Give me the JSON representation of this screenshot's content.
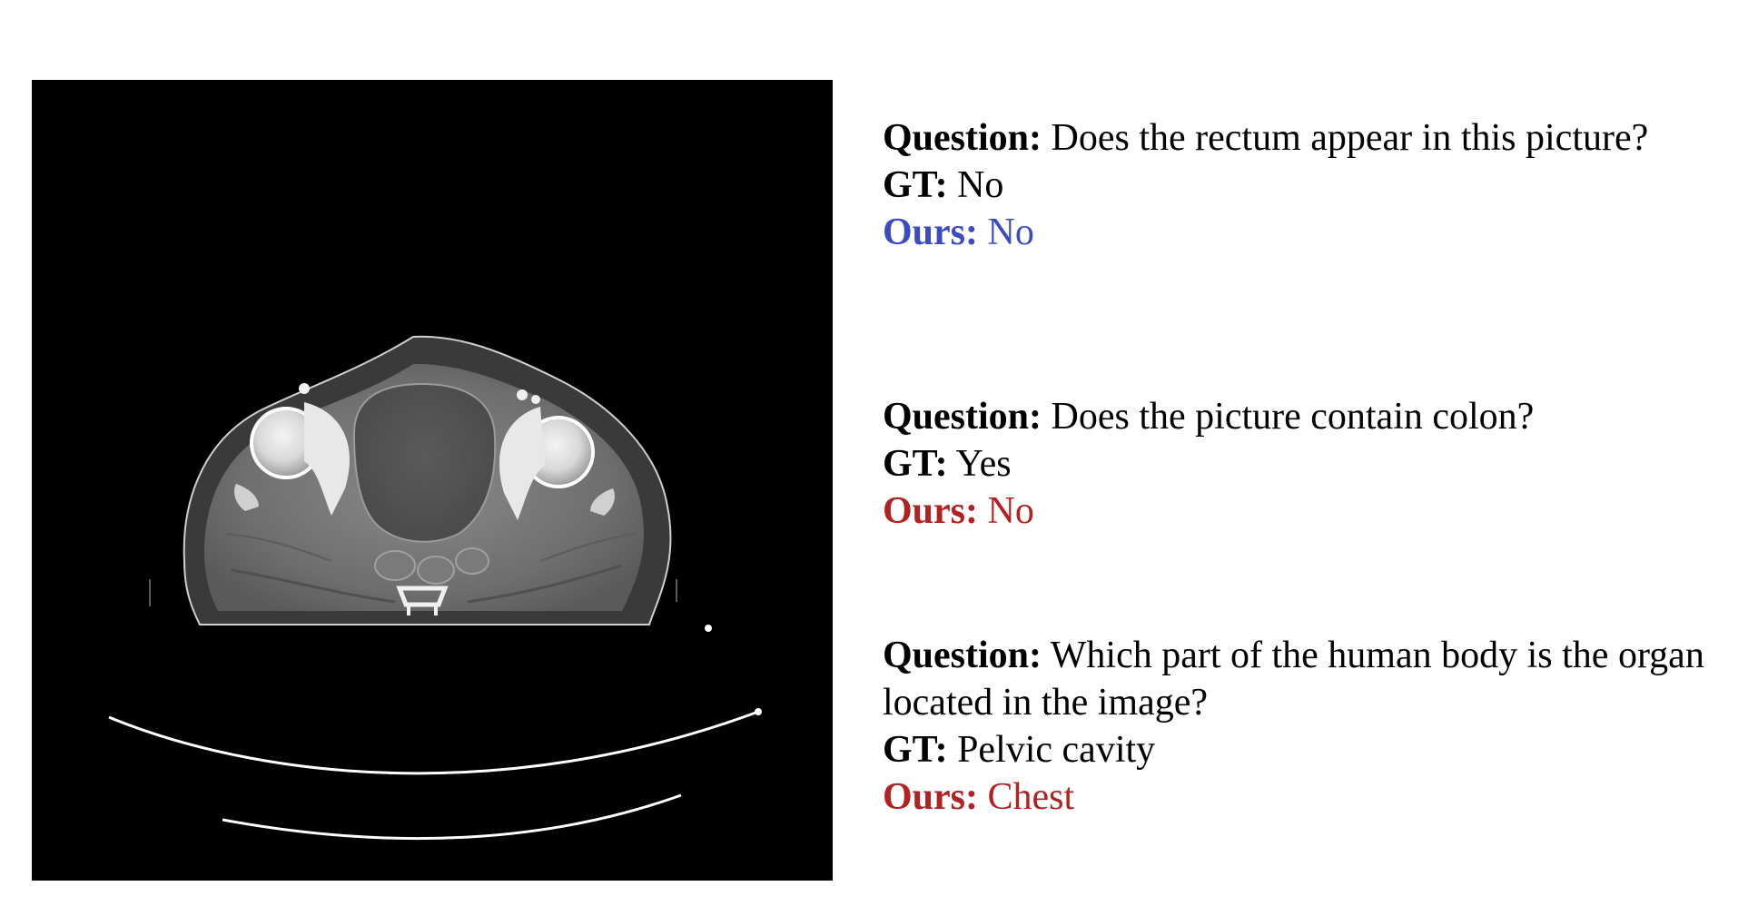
{
  "figure": {
    "image_alt": "Axial CT scan of the pelvis",
    "qa": [
      {
        "question_label": "Question:",
        "question": "Does the rectum appear in this picture?",
        "gt_label": "GT:",
        "gt": "No",
        "ours_label": "Ours:",
        "ours": "No",
        "ours_color": "#3b4cc0",
        "ours_correct": true
      },
      {
        "question_label": "Question:",
        "question": "Does the picture contain colon?",
        "gt_label": "GT:",
        "gt": "Yes",
        "ours_label": "Ours:",
        "ours": "No",
        "ours_color": "#b22222",
        "ours_correct": false
      },
      {
        "question_label": "Question:",
        "question": "Which part of the human body is the organ located in the image?",
        "gt_label": "GT:",
        "gt": "Pelvic cavity",
        "ours_label": "Ours:",
        "ours": "Chest",
        "ours_color": "#b22222",
        "ours_correct": false
      }
    ]
  }
}
